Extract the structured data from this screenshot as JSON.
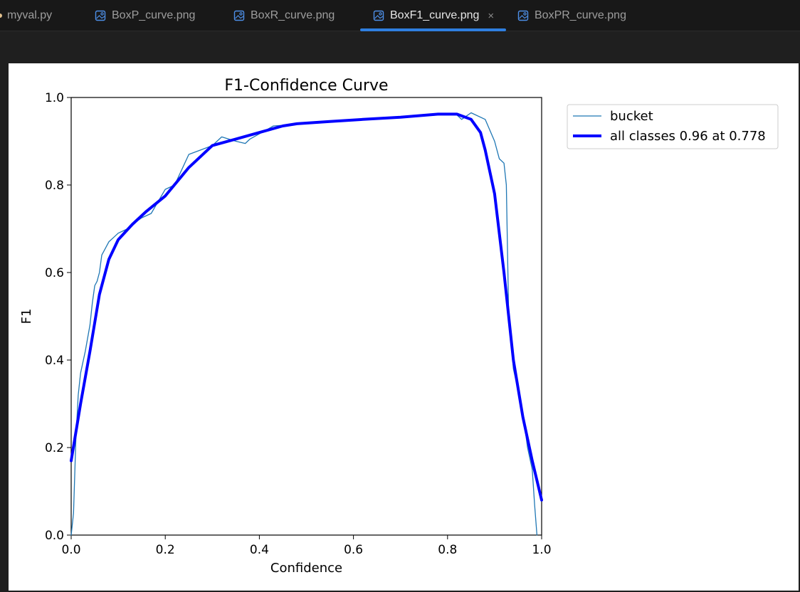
{
  "tabs": [
    {
      "label": "myval.py",
      "kind": "python",
      "active": false
    },
    {
      "label": "BoxP_curve.png",
      "kind": "image",
      "active": false
    },
    {
      "label": "BoxR_curve.png",
      "kind": "image",
      "active": false
    },
    {
      "label": "BoxF1_curve.png",
      "kind": "image",
      "active": true,
      "close_glyph": "×"
    },
    {
      "label": "BoxPR_curve.png",
      "kind": "image",
      "active": false
    }
  ],
  "colors": {
    "accent": "#2f7fe0",
    "series_thin": "#1f77b4",
    "series_thick": "#0000ff",
    "background": "#1f1f1f"
  },
  "chart_data": {
    "type": "line",
    "title": "F1-Confidence Curve",
    "xlabel": "Confidence",
    "ylabel": "F1",
    "xlim": [
      0.0,
      1.0
    ],
    "ylim": [
      0.0,
      1.0
    ],
    "xticks": [
      "0.0",
      "0.2",
      "0.4",
      "0.6",
      "0.8",
      "1.0"
    ],
    "yticks": [
      "0.0",
      "0.2",
      "0.4",
      "0.6",
      "0.8",
      "1.0"
    ],
    "grid": false,
    "legend_position": "outside-top-right",
    "series": [
      {
        "name": "bucket",
        "style": "thin",
        "x": [
          0.0,
          0.005,
          0.01,
          0.015,
          0.02,
          0.03,
          0.04,
          0.045,
          0.05,
          0.055,
          0.06,
          0.065,
          0.07,
          0.08,
          0.09,
          0.1,
          0.11,
          0.12,
          0.13,
          0.15,
          0.17,
          0.2,
          0.22,
          0.25,
          0.3,
          0.32,
          0.35,
          0.37,
          0.38,
          0.43,
          0.5,
          0.6,
          0.7,
          0.78,
          0.82,
          0.83,
          0.85,
          0.88,
          0.9,
          0.91,
          0.92,
          0.925,
          0.93,
          0.94,
          0.95,
          0.96,
          0.97,
          0.98,
          0.985,
          0.99
        ],
        "y": [
          0.0,
          0.05,
          0.22,
          0.32,
          0.37,
          0.42,
          0.48,
          0.53,
          0.57,
          0.58,
          0.6,
          0.64,
          0.65,
          0.67,
          0.68,
          0.69,
          0.695,
          0.7,
          0.71,
          0.725,
          0.735,
          0.79,
          0.8,
          0.87,
          0.89,
          0.91,
          0.9,
          0.895,
          0.905,
          0.935,
          0.94,
          0.95,
          0.955,
          0.96,
          0.96,
          0.95,
          0.965,
          0.95,
          0.9,
          0.86,
          0.85,
          0.8,
          0.5,
          0.38,
          0.33,
          0.28,
          0.2,
          0.15,
          0.07,
          0.0
        ]
      },
      {
        "name": "all classes 0.96 at 0.778",
        "style": "thick",
        "x": [
          0.0,
          0.02,
          0.04,
          0.06,
          0.08,
          0.1,
          0.13,
          0.16,
          0.2,
          0.25,
          0.3,
          0.35,
          0.4,
          0.45,
          0.48,
          0.55,
          0.62,
          0.7,
          0.78,
          0.82,
          0.85,
          0.87,
          0.88,
          0.9,
          0.92,
          0.94,
          0.96,
          0.98,
          1.0
        ],
        "y": [
          0.17,
          0.3,
          0.42,
          0.55,
          0.63,
          0.675,
          0.71,
          0.74,
          0.775,
          0.84,
          0.89,
          0.905,
          0.92,
          0.935,
          0.94,
          0.945,
          0.95,
          0.955,
          0.962,
          0.962,
          0.95,
          0.92,
          0.88,
          0.78,
          0.6,
          0.4,
          0.27,
          0.17,
          0.08
        ]
      }
    ]
  }
}
